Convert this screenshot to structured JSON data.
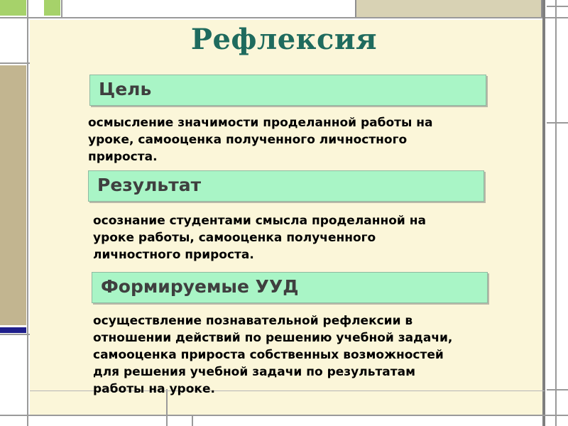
{
  "slide": {
    "title": "Рефлексия",
    "sections": [
      {
        "heading": "Цель",
        "lines": [
          "осмысление значимости проделанной работы на",
          "уроке, самооценка полученного личностного",
          "прироста."
        ]
      },
      {
        "heading": "Результат",
        "lines": [
          "осознание студентами смысла проделанной на",
          "уроке работы, самооценка полученного",
          "личностного прироста."
        ]
      },
      {
        "heading": "Формируемые УУД",
        "lines": [
          "осуществление познавательной рефлексии в",
          "отношении действий по решению учебной задачи,",
          "самооценка прироста собственных возможностей",
          "для решения учебной задачи по результатам",
          "работы на уроке."
        ]
      }
    ]
  },
  "colors": {
    "title": "#1f6b5e",
    "heading_fill": "#a9f5c6",
    "panel": "#fbf6d9",
    "accent_green": "#a6d26a",
    "accent_tan": "#c2b590",
    "accent_navy": "#1f1f8c"
  }
}
